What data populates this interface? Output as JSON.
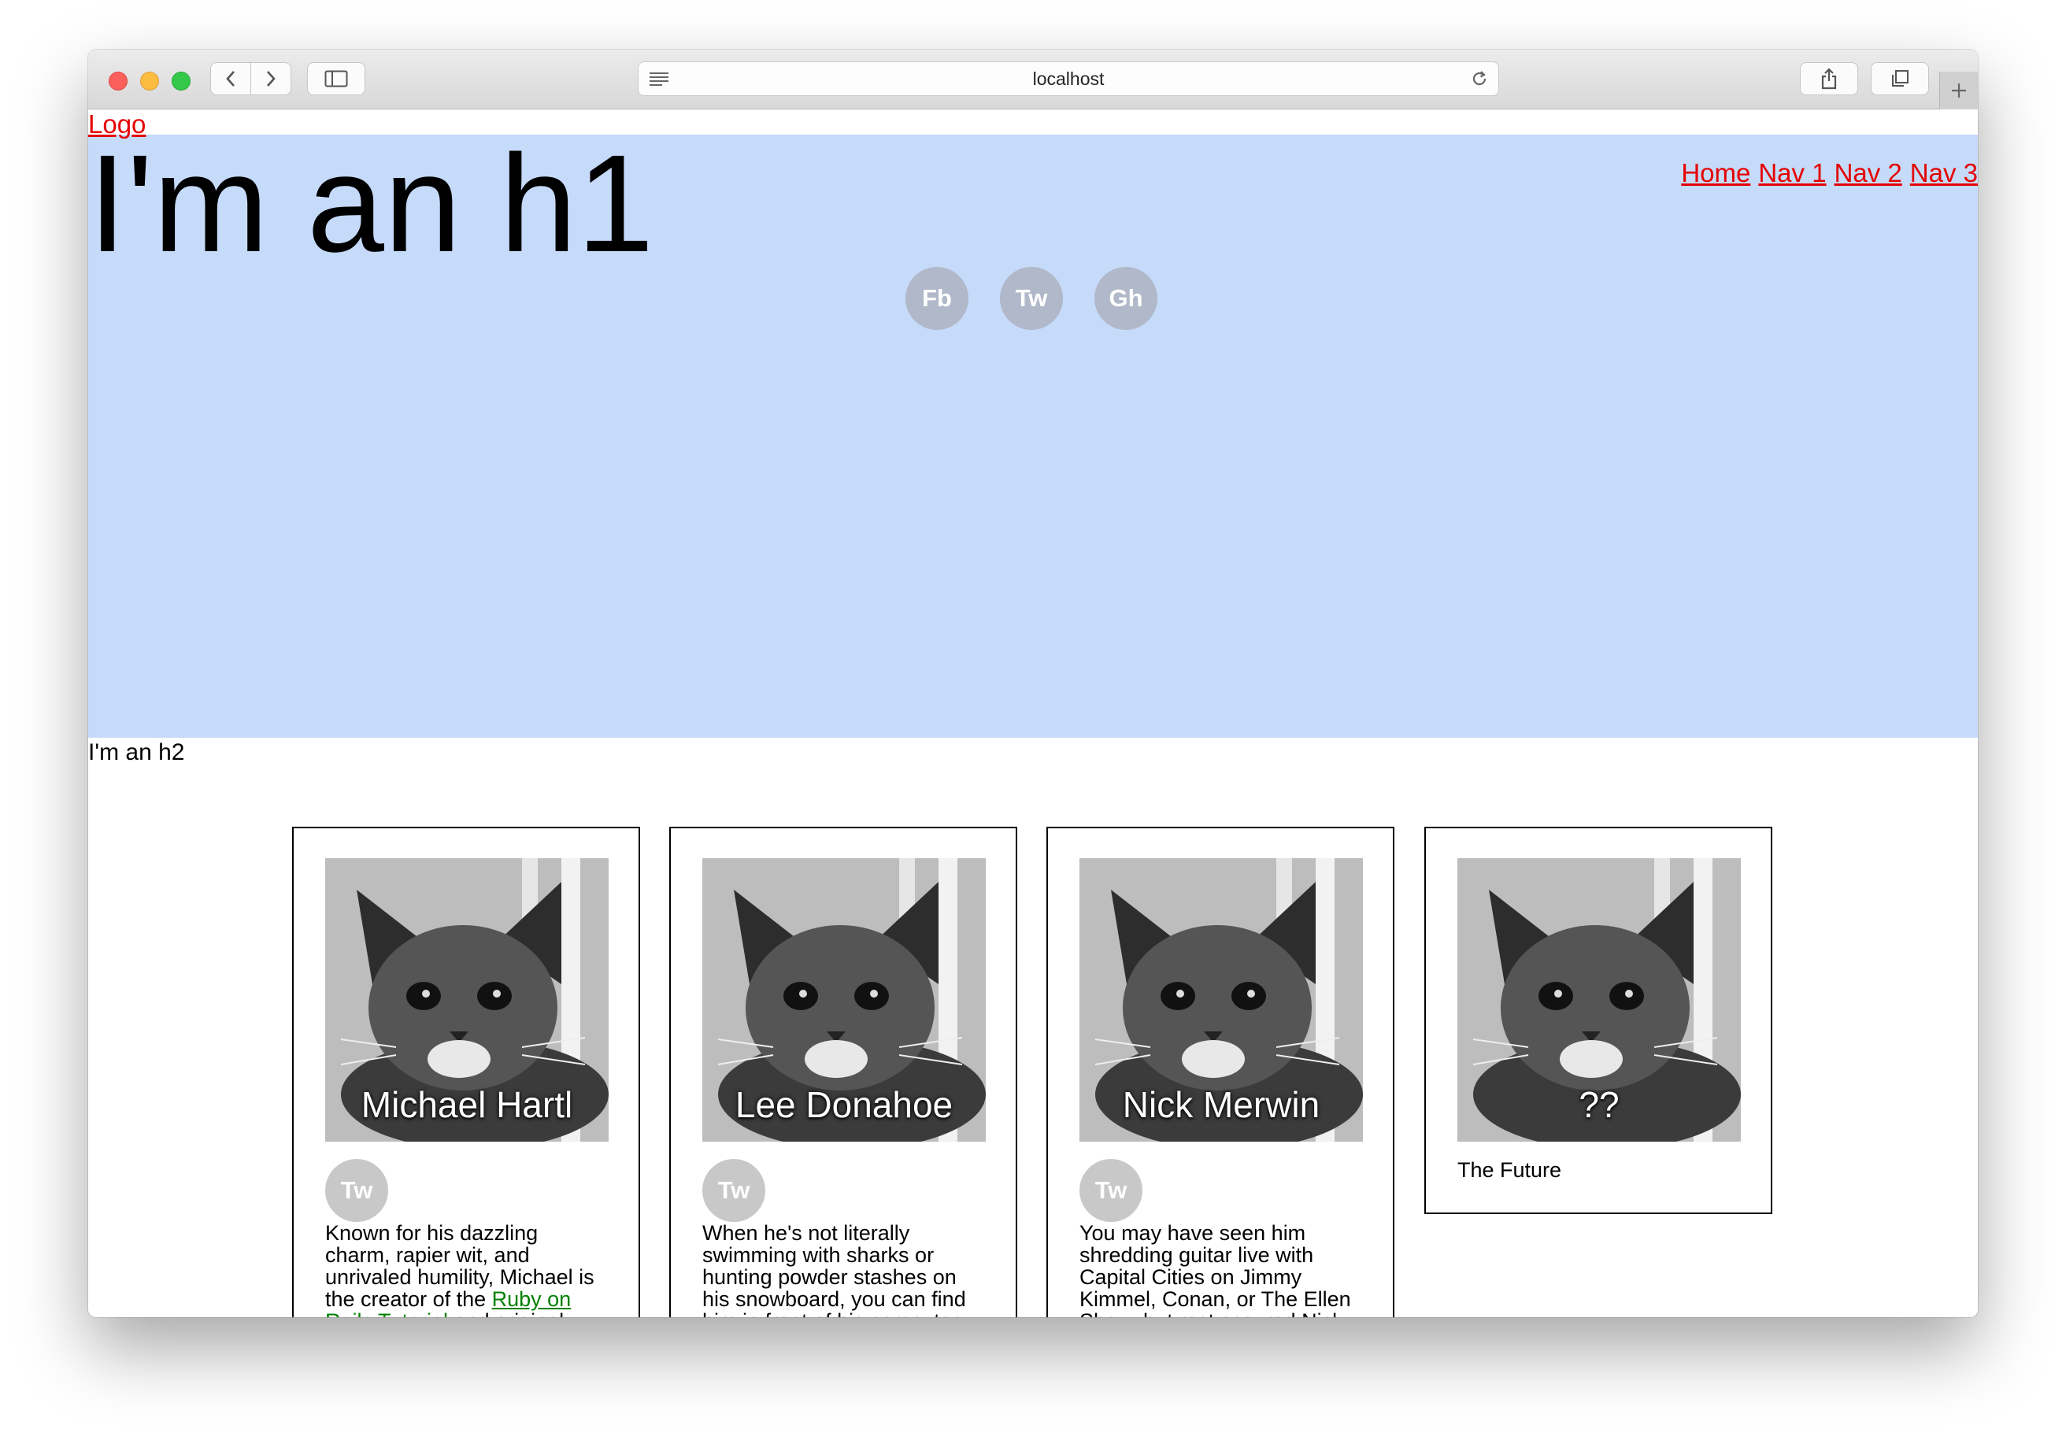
{
  "browser": {
    "url": "localhost"
  },
  "page": {
    "logo": "Logo",
    "h1": "I'm an h1",
    "nav": [
      "Home",
      "Nav 1",
      "Nav 2",
      "Nav 3"
    ],
    "social": [
      "Fb",
      "Tw",
      "Gh"
    ],
    "h2": "I'm an h2"
  },
  "cards": [
    {
      "name": "Michael Hartl",
      "tw": "Tw",
      "bio_before": "Known for his dazzling charm, rapier wit, and unrivaled humility, Michael is the creator of the ",
      "bio_link": "Ruby on Rails Tutorial",
      "bio_after": " and original"
    },
    {
      "name": "Lee Donahoe",
      "tw": "Tw",
      "bio": "When he's not literally swimming with sharks or hunting powder stashes on his snowboard, you can find him in front of his computer too"
    },
    {
      "name": "Nick Merwin",
      "tw": "Tw",
      "bio": "You may have seen him shredding guitar live with Capital Cities on Jimmy Kimmel, Conan, or The Ellen Show, but rest assured Nick"
    },
    {
      "name": "??",
      "caption": "The Future"
    }
  ]
}
